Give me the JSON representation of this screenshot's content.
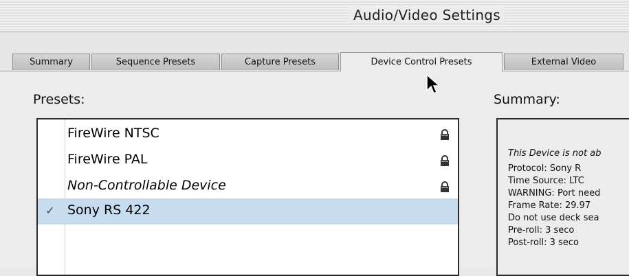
{
  "window": {
    "title": "Audio/Video Settings"
  },
  "tabs": [
    {
      "label": "Summary"
    },
    {
      "label": "Sequence Presets"
    },
    {
      "label": "Capture Presets"
    },
    {
      "label": "Device Control Presets",
      "active": true
    },
    {
      "label": "External Video"
    }
  ],
  "presets": {
    "label": "Presets:",
    "items": [
      {
        "name": "FireWire NTSC",
        "locked": true,
        "checked": false
      },
      {
        "name": "FireWire PAL",
        "locked": true,
        "checked": false
      },
      {
        "name": "Non-Controllable Device",
        "locked": true,
        "checked": false
      },
      {
        "name": "Sony RS 422",
        "locked": false,
        "checked": true,
        "check_mark": "✓"
      }
    ]
  },
  "summary": {
    "label": "Summary:",
    "note": "This Device is not ab",
    "lines": [
      "Protocol:      Sony R",
      "Time Source: LTC",
      "WARNING: Port need",
      "Frame Rate:  29.97",
      "Do not use deck sea",
      "Pre-roll:        3 seco",
      "Post-roll:      3 seco"
    ]
  },
  "colors": {
    "selection": "#c8dcf0",
    "window_bg": "#ececec"
  },
  "icons": {
    "lock": "lock-icon",
    "cursor": "arrow-cursor-icon"
  }
}
